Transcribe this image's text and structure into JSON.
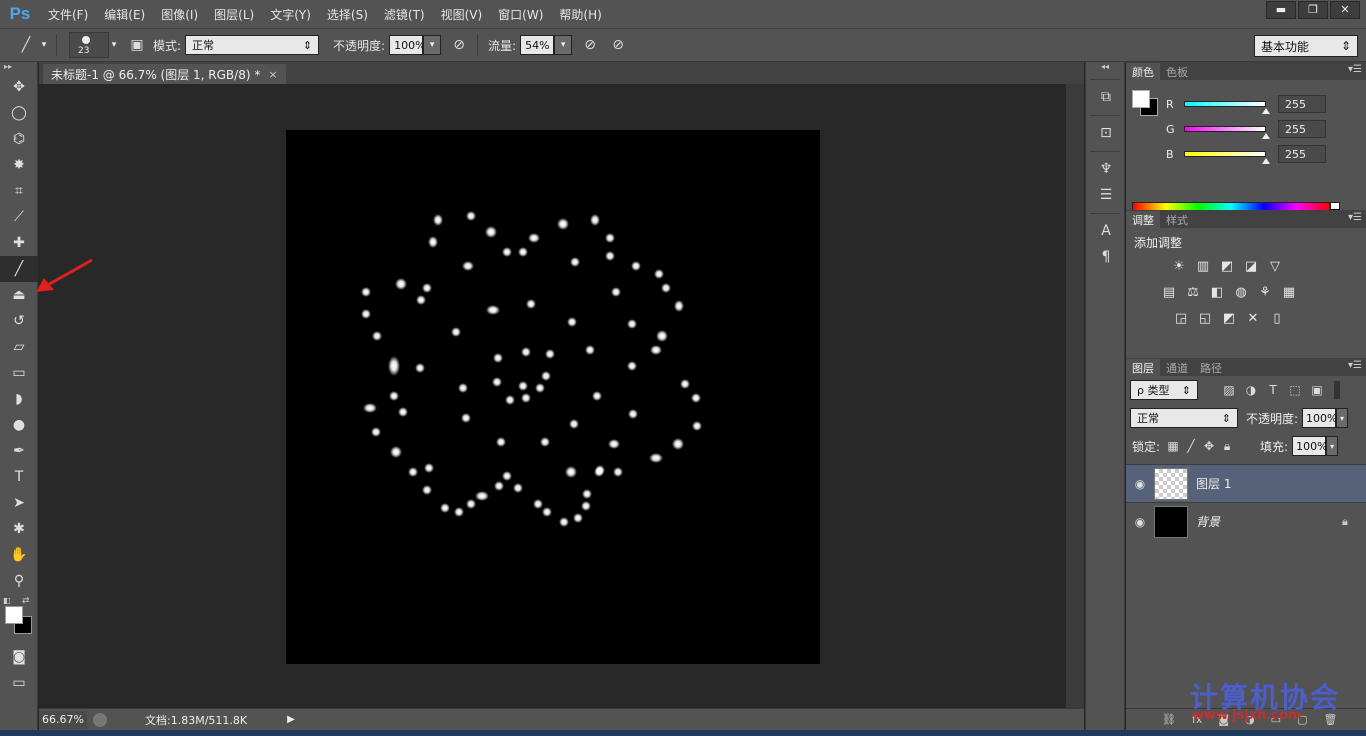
{
  "app": {
    "logo": "Ps",
    "menu": [
      "文件(F)",
      "编辑(E)",
      "图像(I)",
      "图层(L)",
      "文字(Y)",
      "选择(S)",
      "滤镜(T)",
      "视图(V)",
      "窗口(W)",
      "帮助(H)"
    ],
    "window_controls": {
      "minimize": "▬",
      "restore": "❐",
      "close": "✕"
    }
  },
  "options": {
    "brush_size": "23",
    "mode_label": "模式:",
    "mode_value": "正常",
    "opacity_label": "不透明度:",
    "opacity_value": "100%",
    "flow_label": "流量:",
    "flow_value": "54%",
    "workspace": "基本功能"
  },
  "document": {
    "tab_title": "未标题-1 @ 66.7% (图层 1, RGB/8) *",
    "tab_close": "×",
    "zoom": "66.67%",
    "doc_info": "文档:1.83M/511.8K",
    "status_arrow": "▶"
  },
  "tools": [
    {
      "name": "move-tool",
      "glyph": "✥"
    },
    {
      "name": "elliptical-marquee-tool",
      "glyph": "◯"
    },
    {
      "name": "polygonal-lasso-tool",
      "glyph": "⌬"
    },
    {
      "name": "magic-wand-tool",
      "glyph": "✸"
    },
    {
      "name": "crop-tool",
      "glyph": "⌗"
    },
    {
      "name": "eyedropper-tool",
      "glyph": "⟋"
    },
    {
      "name": "healing-brush-tool",
      "glyph": "✚"
    },
    {
      "name": "brush-tool",
      "glyph": "╱",
      "active": true
    },
    {
      "name": "clone-stamp-tool",
      "glyph": "⏏"
    },
    {
      "name": "history-brush-tool",
      "glyph": "↺"
    },
    {
      "name": "eraser-tool",
      "glyph": "▱"
    },
    {
      "name": "gradient-tool",
      "glyph": "▭"
    },
    {
      "name": "blur-tool",
      "glyph": "◗"
    },
    {
      "name": "dodge-tool",
      "glyph": "●"
    },
    {
      "name": "pen-tool",
      "glyph": "✒"
    },
    {
      "name": "type-tool",
      "glyph": "T"
    },
    {
      "name": "path-selection-tool",
      "glyph": "➤"
    },
    {
      "name": "custom-shape-tool",
      "glyph": "✱"
    },
    {
      "name": "hand-tool",
      "glyph": "✋"
    },
    {
      "name": "zoom-tool",
      "glyph": "⚲"
    }
  ],
  "color_panel": {
    "tabs": [
      "颜色",
      "色板"
    ],
    "channels": [
      {
        "label": "R",
        "value": "255",
        "gradient": "linear-gradient(to right, #00ffff, #ffffff)"
      },
      {
        "label": "G",
        "value": "255",
        "gradient": "linear-gradient(to right, #ff00ff, #ffffff)"
      },
      {
        "label": "B",
        "value": "255",
        "gradient": "linear-gradient(to right, #ffff00, #ffffff)"
      }
    ]
  },
  "adjustments_panel": {
    "tabs": [
      "调整",
      "样式"
    ],
    "title": "添加调整",
    "rows": [
      [
        "☀",
        "▥",
        "◩",
        "◪",
        "▽"
      ],
      [
        "▤",
        "⚖",
        "◧",
        "◍",
        "⚘",
        "▦"
      ],
      [
        "◲",
        "◱",
        "◩",
        "✕",
        "▯"
      ]
    ]
  },
  "layers_panel": {
    "tabs": [
      "图层",
      "通道",
      "路径"
    ],
    "filter_type": "ρ 类型",
    "blend_mode": "正常",
    "opacity_label": "不透明度:",
    "opacity_value": "100%",
    "lock_label": "锁定:",
    "fill_label": "填充:",
    "fill_value": "100%",
    "layers": [
      {
        "name": "图层 1",
        "selected": true,
        "thumb": "checker"
      },
      {
        "name": "背景",
        "selected": false,
        "thumb": "black",
        "locked": true
      }
    ]
  },
  "watermark": {
    "text": "计算机协会",
    "url": "www.jsjxh.com"
  },
  "canvas_dots": [
    [
      152,
      90,
      5,
      6
    ],
    [
      185,
      86,
      5,
      5
    ],
    [
      205,
      102,
      6,
      6
    ],
    [
      147,
      112,
      5,
      6
    ],
    [
      248,
      108,
      6,
      5
    ],
    [
      277,
      94,
      6,
      6
    ],
    [
      309,
      90,
      5,
      6
    ],
    [
      324,
      108,
      5,
      5
    ],
    [
      221,
      122,
      5,
      5
    ],
    [
      237,
      122,
      5,
      5
    ],
    [
      182,
      136,
      6,
      5
    ],
    [
      289,
      132,
      5,
      5
    ],
    [
      324,
      126,
      5,
      5
    ],
    [
      350,
      136,
      5,
      5
    ],
    [
      373,
      144,
      5,
      5
    ],
    [
      80,
      162,
      5,
      5
    ],
    [
      115,
      154,
      6,
      6
    ],
    [
      141,
      158,
      5,
      5
    ],
    [
      135,
      170,
      5,
      5
    ],
    [
      330,
      162,
      5,
      5
    ],
    [
      380,
      158,
      5,
      5
    ],
    [
      393,
      176,
      5,
      6
    ],
    [
      80,
      184,
      5,
      5
    ],
    [
      207,
      180,
      7,
      5
    ],
    [
      245,
      174,
      5,
      5
    ],
    [
      286,
      192,
      5,
      5
    ],
    [
      346,
      194,
      5,
      5
    ],
    [
      91,
      206,
      5,
      5
    ],
    [
      170,
      202,
      5,
      5
    ],
    [
      376,
      206,
      6,
      6
    ],
    [
      370,
      220,
      6,
      5
    ],
    [
      212,
      228,
      5,
      5
    ],
    [
      240,
      222,
      5,
      5
    ],
    [
      264,
      224,
      5,
      5
    ],
    [
      304,
      220,
      5,
      5
    ],
    [
      108,
      236,
      6,
      10
    ],
    [
      134,
      238,
      5,
      5
    ],
    [
      211,
      252,
      5,
      5
    ],
    [
      260,
      246,
      5,
      5
    ],
    [
      346,
      236,
      5,
      5
    ],
    [
      177,
      258,
      5,
      5
    ],
    [
      237,
      256,
      5,
      5
    ],
    [
      254,
      258,
      5,
      5
    ],
    [
      108,
      266,
      5,
      5
    ],
    [
      224,
      270,
      5,
      5
    ],
    [
      240,
      268,
      5,
      5
    ],
    [
      311,
      266,
      5,
      5
    ],
    [
      399,
      254,
      5,
      5
    ],
    [
      410,
      268,
      5,
      5
    ],
    [
      84,
      278,
      7,
      5
    ],
    [
      117,
      282,
      5,
      5
    ],
    [
      180,
      288,
      5,
      5
    ],
    [
      347,
      284,
      5,
      5
    ],
    [
      288,
      294,
      5,
      5
    ],
    [
      411,
      296,
      5,
      5
    ],
    [
      90,
      302,
      5,
      5
    ],
    [
      215,
      312,
      5,
      5
    ],
    [
      259,
      312,
      5,
      5
    ],
    [
      328,
      314,
      6,
      5
    ],
    [
      392,
      314,
      6,
      6
    ],
    [
      370,
      328,
      7,
      5
    ],
    [
      110,
      322,
      6,
      6
    ],
    [
      127,
      342,
      5,
      5
    ],
    [
      143,
      338,
      5,
      5
    ],
    [
      285,
      342,
      6,
      6
    ],
    [
      313,
      342,
      5,
      5
    ],
    [
      332,
      342,
      5,
      5
    ],
    [
      221,
      346,
      5,
      5
    ],
    [
      232,
      358,
      5,
      5
    ],
    [
      213,
      356,
      5,
      5
    ],
    [
      314,
      340,
      5,
      5
    ],
    [
      141,
      360,
      5,
      5
    ],
    [
      196,
      366,
      7,
      5
    ],
    [
      185,
      374,
      5,
      5
    ],
    [
      301,
      364,
      5,
      5
    ],
    [
      252,
      374,
      5,
      5
    ],
    [
      261,
      382,
      5,
      5
    ],
    [
      278,
      392,
      5,
      5
    ],
    [
      292,
      388,
      5,
      5
    ],
    [
      300,
      376,
      5,
      5
    ],
    [
      159,
      378,
      5,
      5
    ],
    [
      173,
      382,
      5,
      5
    ]
  ]
}
